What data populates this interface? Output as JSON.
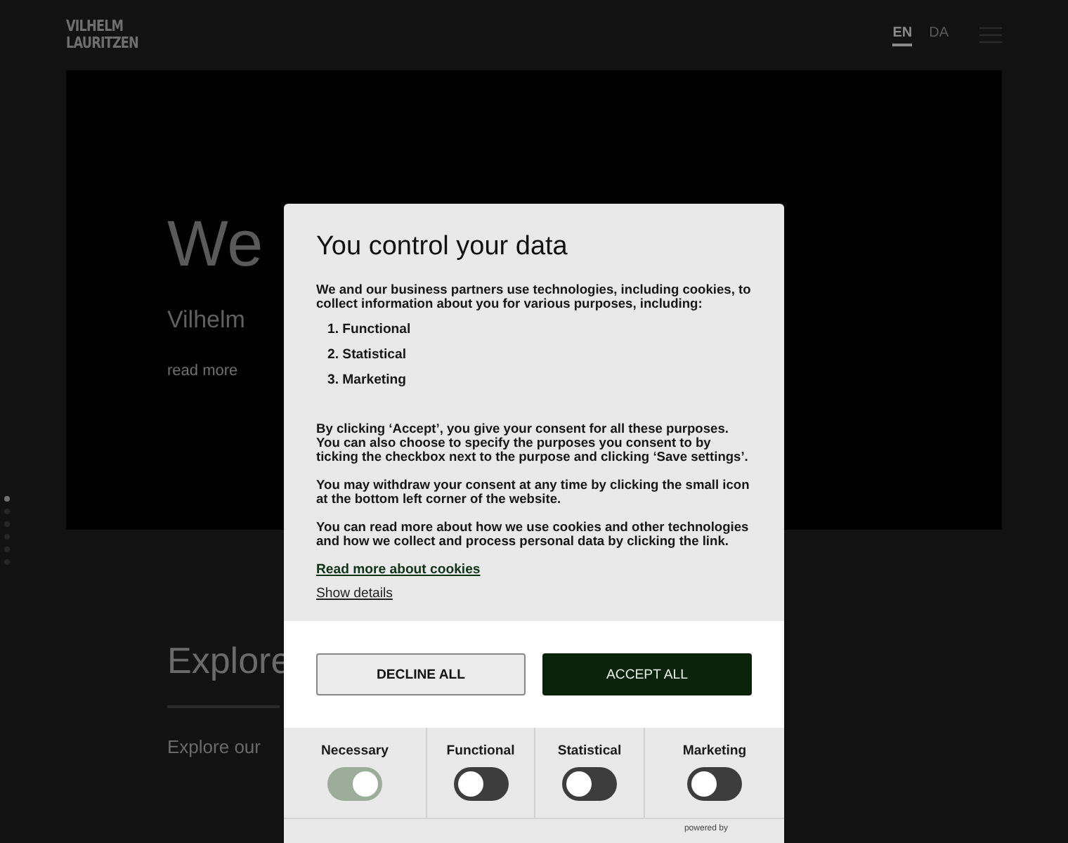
{
  "header": {
    "logo": [
      "VILHELM",
      "LAURITZEN"
    ],
    "languages": [
      {
        "label": "EN",
        "selected": true
      },
      {
        "label": "DA",
        "selected": false
      }
    ]
  },
  "hero": {
    "heading": "We",
    "subheading": "Vilhelm",
    "link": "read more"
  },
  "slide_dots": [
    {
      "selected": true
    },
    {
      "selected": false
    },
    {
      "selected": false
    },
    {
      "selected": false
    },
    {
      "selected": false
    },
    {
      "selected": false
    }
  ],
  "section": {
    "heading": "Explore",
    "text": "Explore our"
  },
  "dialog": {
    "title": "You control your data",
    "intro": "We and our business partners use technologies, including cookies, to collect information about you for various purposes, including:",
    "purposes": [
      "1. Functional",
      "2. Statistical",
      "3. Marketing"
    ],
    "paragraphs": [
      "By clicking ‘Accept’, you give your consent for all these purposes. You can also choose to specify the purposes you consent to by ticking the checkbox next to the purpose and clicking ‘Save settings’.",
      "You may withdraw your consent at any time by clicking the small icon at the bottom left corner of the website.",
      "You can read more about how we use cookies and other technologies and how we collect and process personal data by clicking the link."
    ],
    "links": [
      "Read more about cookies",
      "Show details"
    ],
    "buttons": [
      {
        "label": "DECLINE ALL",
        "kind": "secondary"
      },
      {
        "label": "ACCEPT ALL",
        "kind": "primary"
      }
    ],
    "toggles": [
      {
        "label": "Necessary",
        "on": true,
        "disabled": true
      },
      {
        "label": "Functional",
        "on": false,
        "disabled": false
      },
      {
        "label": "Statistical",
        "on": false,
        "disabled": false
      },
      {
        "label": "Marketing",
        "on": false,
        "disabled": false
      }
    ],
    "footer": "powered by"
  }
}
